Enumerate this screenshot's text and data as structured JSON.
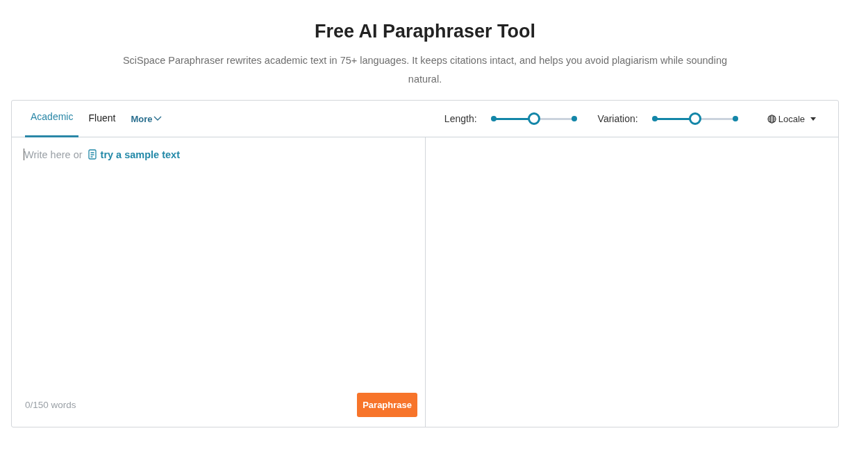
{
  "title": "Free AI Paraphraser Tool",
  "subtitle": "SciSpace Paraphraser rewrites academic text in 75+ languages. It keeps citations intact, and helps you avoid plagiarism while sounding natural.",
  "tabs": [
    {
      "label": "Academic",
      "selected": true
    },
    {
      "label": "Fluent",
      "selected": false
    }
  ],
  "more": {
    "label": "More"
  },
  "sliders": [
    {
      "label": "Length:",
      "level": 0.5
    },
    {
      "label": "Variation:",
      "level": 0.5
    }
  ],
  "locale": {
    "label": "Locale"
  },
  "input": {
    "placeholder": "Write here or",
    "sample_link": "try a sample text"
  },
  "word_count": "0/150 words",
  "button": "Paraphrase"
}
